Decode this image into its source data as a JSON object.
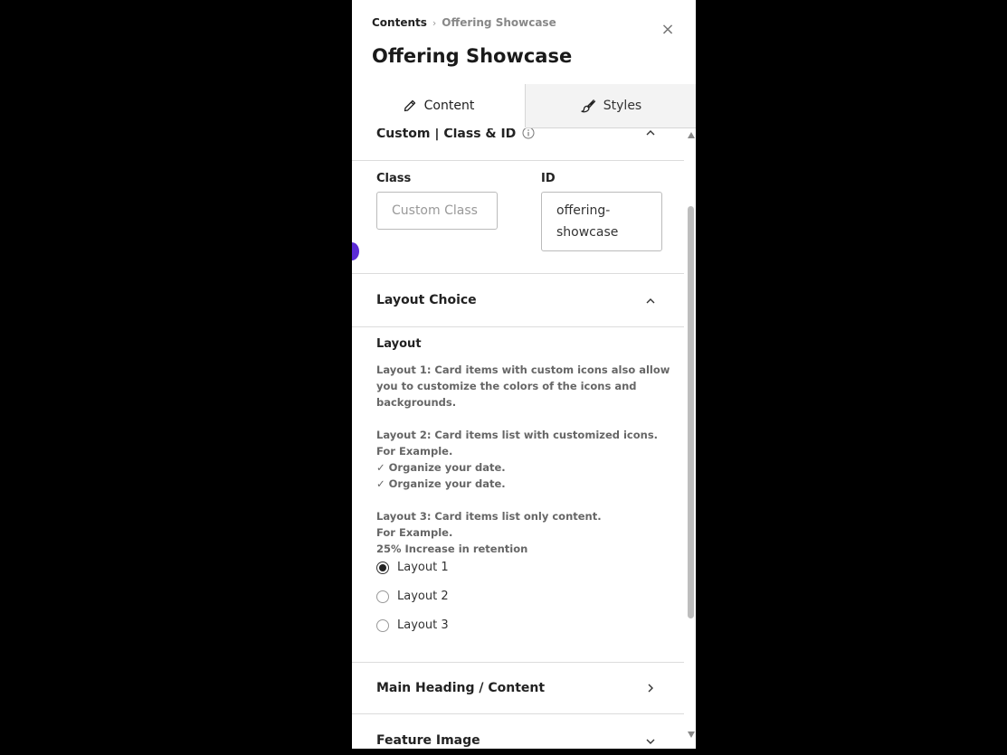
{
  "header": {
    "breadcrumb_root": "Contents",
    "breadcrumb_separator": "›",
    "breadcrumb_current": "Offering Showcase",
    "title": "Offering Showcase",
    "close_glyph": "×"
  },
  "tabs": [
    {
      "label": "Content",
      "icon": "pencil-icon",
      "active": true
    },
    {
      "label": "Styles",
      "icon": "brush-icon",
      "active": false
    }
  ],
  "custom_section": {
    "title": "Custom | Class & ID",
    "info_icon": "info-icon",
    "class_label": "Class",
    "class_placeholder": "Custom Class",
    "id_label": "ID",
    "id_value": "offering-showcase"
  },
  "layout_section": {
    "title": "Layout Choice",
    "field_label": "Layout",
    "description_lines": [
      "Layout 1: Card items with custom icons also allow",
      "you to customize the colors of the icons and",
      "backgrounds.",
      "",
      "Layout 2: Card items list with customized icons.",
      "For Example.",
      "✓ Organize your date.",
      "✓ Organize your date.",
      "",
      "Layout 3: Card items list only content.",
      "For Example.",
      "25% Increase in retention"
    ],
    "options": [
      {
        "label": "Layout 1",
        "checked": true
      },
      {
        "label": "Layout 2",
        "checked": false
      },
      {
        "label": "Layout 3",
        "checked": false
      }
    ]
  },
  "main_heading_section": {
    "title": "Main Heading / Content"
  },
  "feature_image_section": {
    "title": "Feature Image"
  },
  "colors": {
    "accent": "#5b2bd6",
    "border": "#d6d6d6"
  }
}
